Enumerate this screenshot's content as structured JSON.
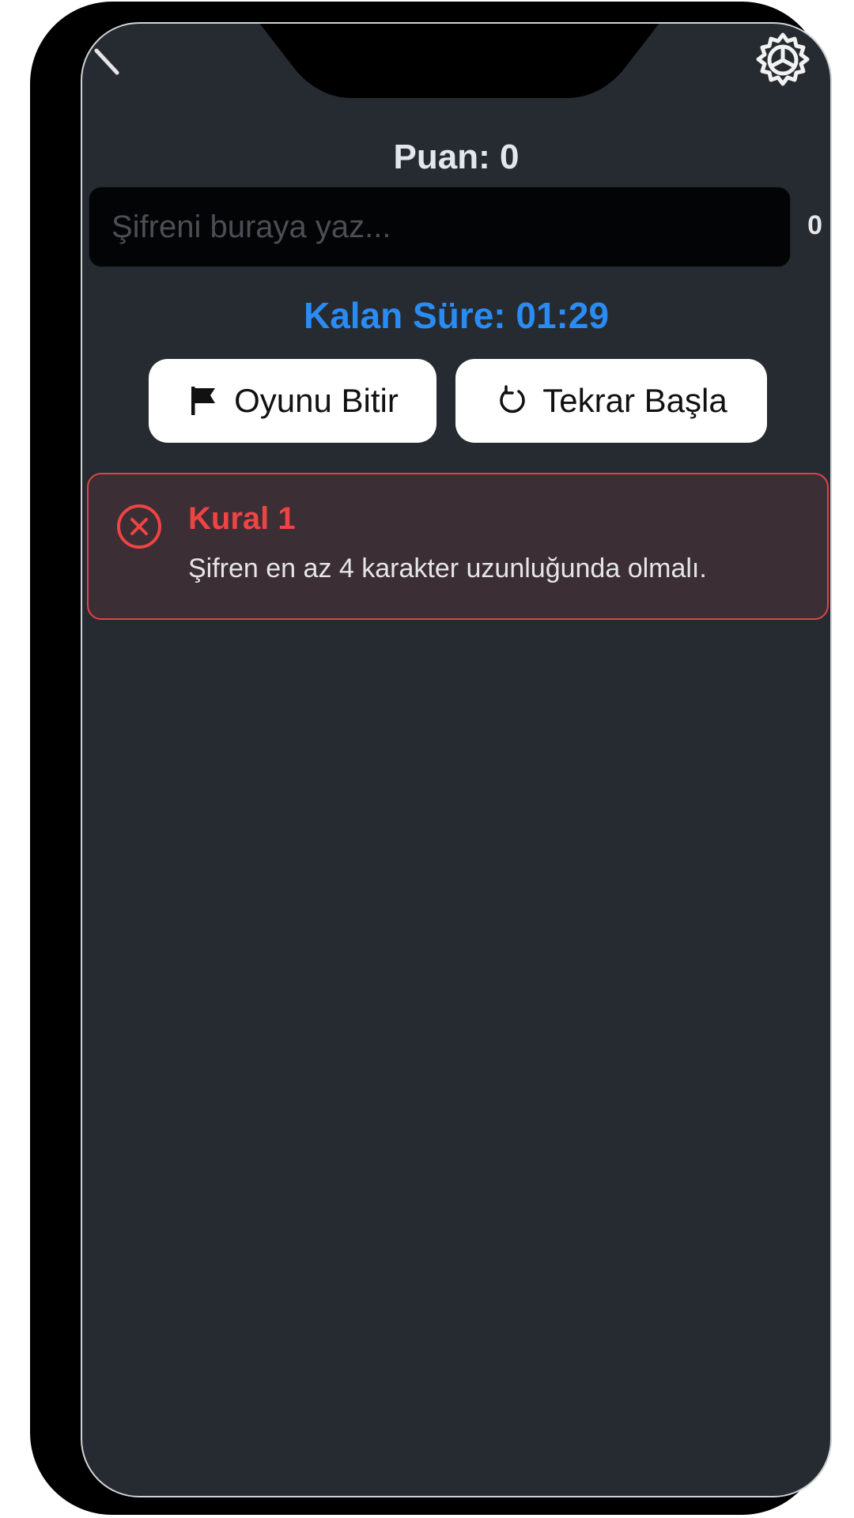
{
  "header": {
    "score_text": "Puan: 0"
  },
  "password": {
    "placeholder": "Şifreni buraya yaz...",
    "value": "",
    "char_count": "0"
  },
  "timer": {
    "text": "Kalan Süre: 01:29"
  },
  "actions": {
    "end_label": "Oyunu Bitir",
    "end_icon": "flag-icon",
    "restart_label": "Tekrar Başla",
    "restart_icon": "refresh-icon"
  },
  "rules": [
    {
      "title": "Kural 1",
      "description": "Şifren en az 4 karakter uzunluğunda olmalı.",
      "status": "failed",
      "status_icon": "close-circle-icon"
    }
  ],
  "colors": {
    "background": "#262b32",
    "accent_timer": "#2a8cf2",
    "error": "#ef4444",
    "error_card_bg": "#3b2e35"
  }
}
